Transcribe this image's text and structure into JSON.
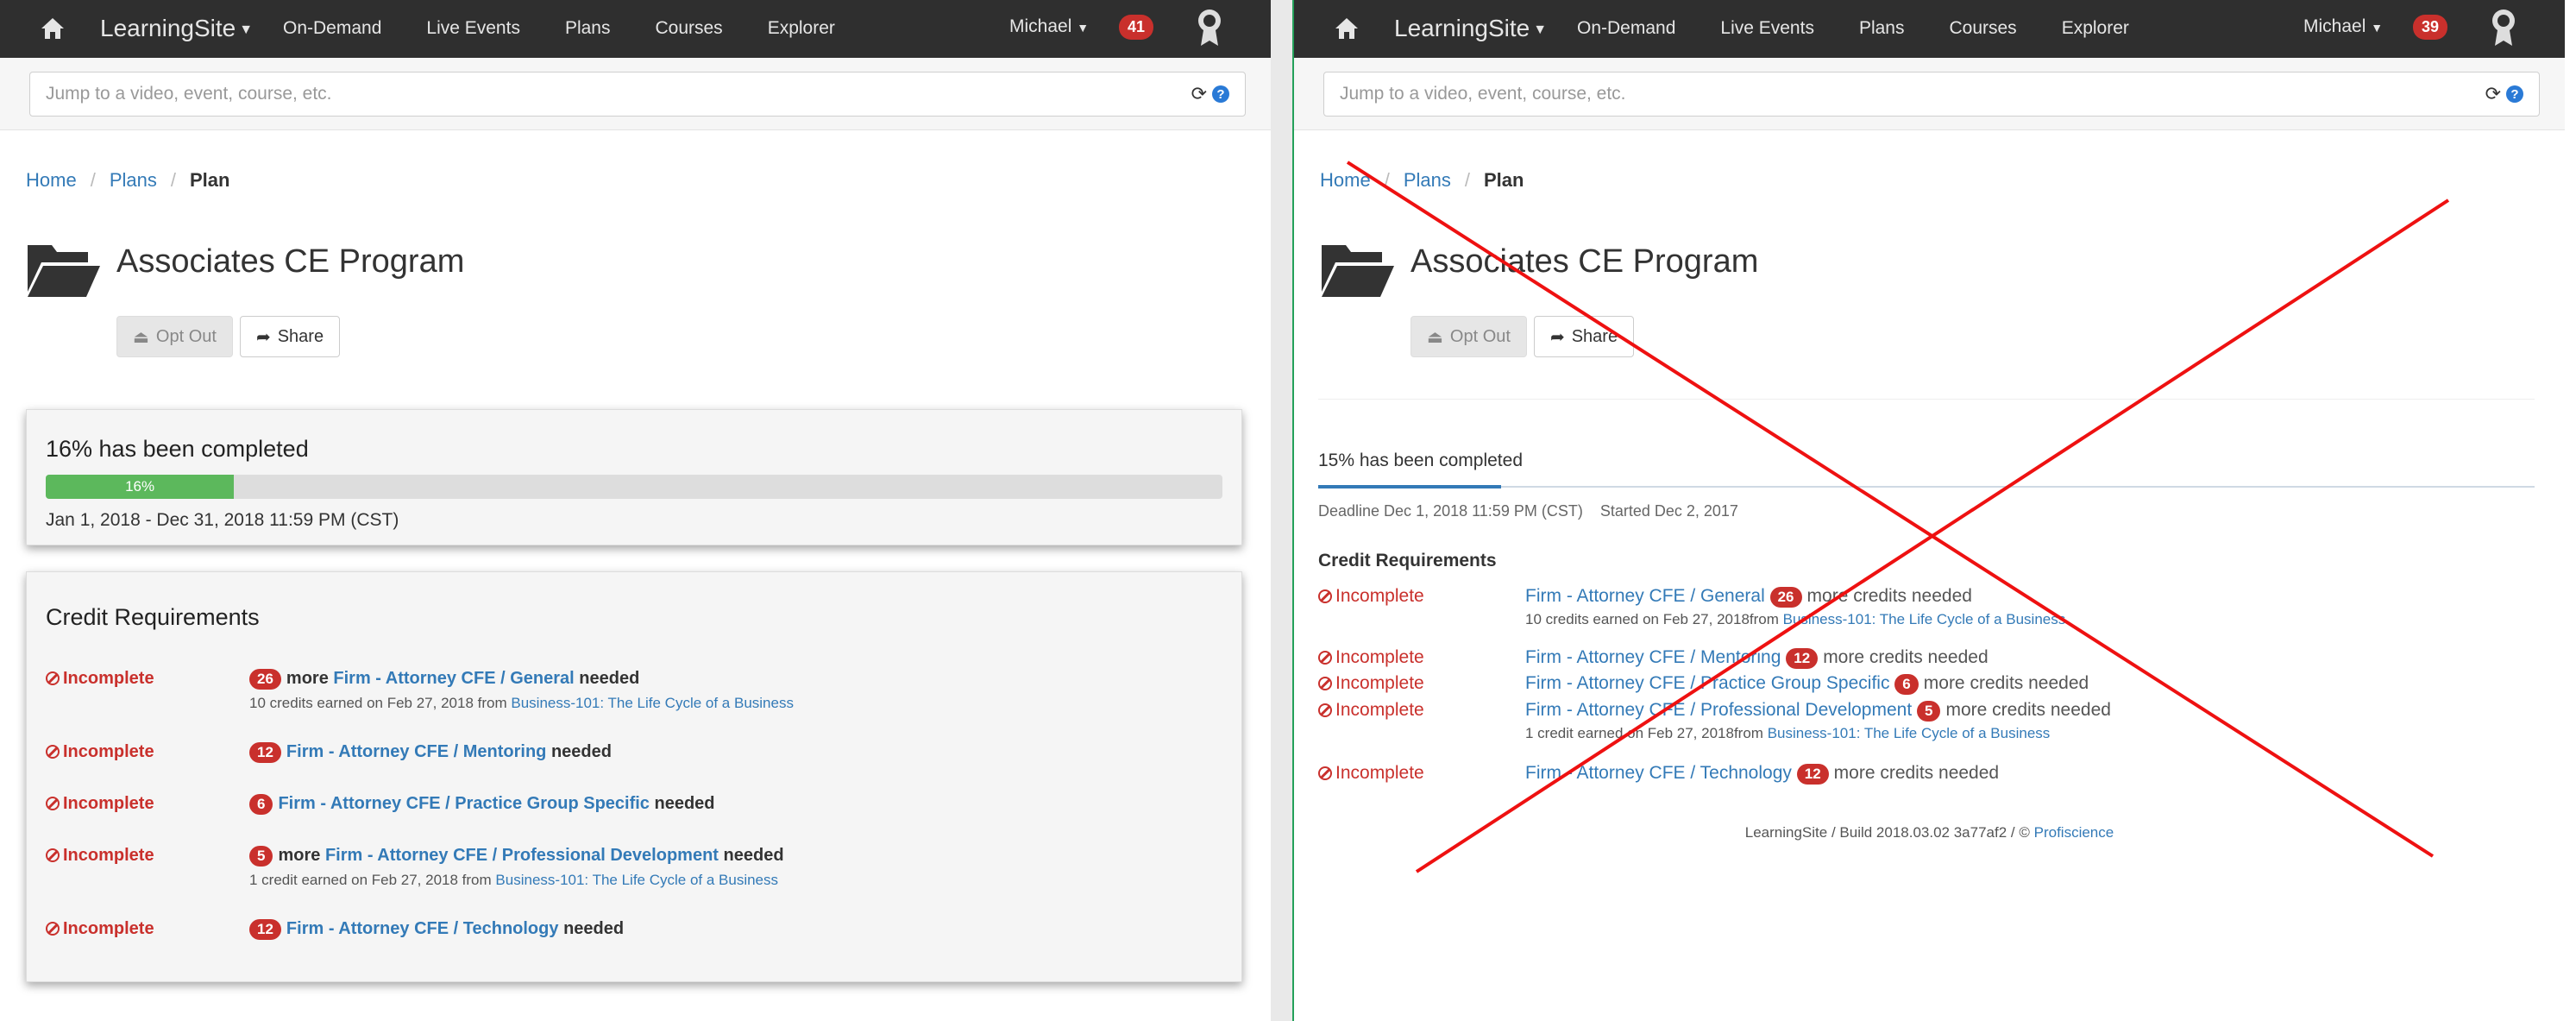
{
  "left": {
    "nav": {
      "brand": "LearningSite",
      "items": [
        "On-Demand",
        "Live Events",
        "Plans",
        "Courses",
        "Explorer"
      ],
      "user": "Michael",
      "notif_count": "41"
    },
    "search": {
      "placeholder": "Jump to a video, event, course, etc."
    },
    "breadcrumb": {
      "home": "Home",
      "plans": "Plans",
      "current": "Plan"
    },
    "title": "Associates CE Program",
    "buttons": {
      "opt_out": "Opt Out",
      "share": "Share"
    },
    "progress": {
      "heading": "16% has been completed",
      "percent_label": "16%",
      "percent": 16,
      "dates": "Jan 1, 2018 - Dec 31, 2018 11:59 PM (CST)"
    },
    "credits": {
      "heading": "Credit Requirements",
      "items": [
        {
          "status": "Incomplete",
          "count": "26",
          "more": "more",
          "link": "Firm - Attorney CFE / General",
          "tail": "needed",
          "sub_text": "10 credits earned on Feb 27, 2018 from",
          "sub_link": "Business-101: The Life Cycle of a Business"
        },
        {
          "status": "Incomplete",
          "count": "12",
          "link": "Firm - Attorney CFE / Mentoring",
          "tail": "needed"
        },
        {
          "status": "Incomplete",
          "count": "6",
          "link": "Firm - Attorney CFE / Practice Group Specific",
          "tail": "needed"
        },
        {
          "status": "Incomplete",
          "count": "5",
          "more": "more",
          "link": "Firm - Attorney CFE / Professional Development",
          "tail": "needed",
          "sub_text": "1 credit earned on Feb 27, 2018 from",
          "sub_link": "Business-101: The Life Cycle of a Business"
        },
        {
          "status": "Incomplete",
          "count": "12",
          "link": "Firm - Attorney CFE / Technology",
          "tail": "needed"
        }
      ]
    }
  },
  "right": {
    "nav": {
      "brand": "LearningSite",
      "items": [
        "On-Demand",
        "Live Events",
        "Plans",
        "Courses",
        "Explorer"
      ],
      "user": "Michael",
      "notif_count": "39"
    },
    "search": {
      "placeholder": "Jump to a video, event, course, etc."
    },
    "breadcrumb": {
      "home": "Home",
      "plans": "Plans",
      "current": "Plan"
    },
    "title": "Associates CE Program",
    "buttons": {
      "opt_out": "Opt Out",
      "share": "Share"
    },
    "progress": {
      "heading": "15% has been completed",
      "deadline": "Deadline Dec 1, 2018 11:59 PM (CST)",
      "started": "Started Dec 2, 2017"
    },
    "credits": {
      "heading": "Credit Requirements",
      "items": [
        {
          "status": "Incomplete",
          "link": "Firm - Attorney CFE / General",
          "count": "26",
          "tail": "more credits needed",
          "sub_text": "10 credits earned on Feb 27, 2018from",
          "sub_link": "Business-101: The Life Cycle of a Business"
        },
        {
          "status": "Incomplete",
          "link": "Firm - Attorney CFE / Mentoring",
          "count": "12",
          "tail": "more credits needed"
        },
        {
          "status": "Incomplete",
          "link": "Firm - Attorney CFE / Practice Group Specific",
          "count": "6",
          "tail": "more credits needed"
        },
        {
          "status": "Incomplete",
          "link": "Firm - Attorney CFE / Professional Development",
          "count": "5",
          "tail": "more credits needed",
          "sub_text": "1 credit earned on Feb 27, 2018from",
          "sub_link": "Business-101: The Life Cycle of a Business"
        },
        {
          "status": "Incomplete",
          "link": "Firm - Attorney CFE / Technology",
          "count": "12",
          "tail": "more credits needed"
        }
      ]
    },
    "footer": {
      "text": "LearningSite / Build 2018.03.02 3a77af2 / ©",
      "link": "Profiscience"
    }
  },
  "colors": {
    "accent": "#337ab7",
    "danger": "#c9302c",
    "success": "#5cb85c",
    "navbar": "#2f2f2f",
    "cross": "#ee1111"
  }
}
